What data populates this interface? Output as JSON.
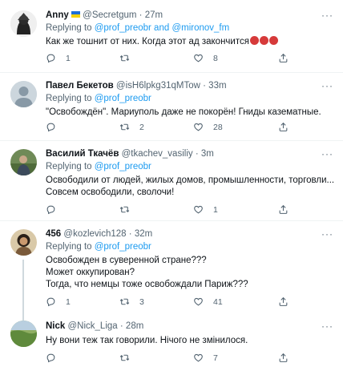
{
  "tweets": [
    {
      "name": "Anny",
      "handle": "@Secretgum",
      "time": "27m",
      "replying_prefix": "Replying to ",
      "replying_to": "@prof_preobr and @mironov_fm",
      "lines": [
        "Как же тошнит от них. Когда этот ад закончится"
      ],
      "emoji": [
        "angry-face",
        "angry-face",
        "angry-face"
      ],
      "replies": "1",
      "retweets": "",
      "likes": "8"
    },
    {
      "name": "Павел Бекетов",
      "handle": "@isH6lpkg31qMTow",
      "time": "33m",
      "replying_prefix": "Replying to ",
      "replying_to": "@prof_preobr",
      "lines": [
        "\"Освобождён\". Мариуполь даже не покорён! Гниды казематные."
      ],
      "replies": "",
      "retweets": "2",
      "likes": "28"
    },
    {
      "name": "Василий Ткачёв",
      "handle": "@tkachev_vasiliy",
      "time": "3m",
      "replying_prefix": "Replying to ",
      "replying_to": "@prof_preobr",
      "lines": [
        "Освободили от людей, жилых домов, промышленности, торговли...",
        "Совсем освободили, сволочи!"
      ],
      "replies": "",
      "retweets": "",
      "likes": "1"
    },
    {
      "name": "456",
      "handle": "@kozlevich128",
      "time": "32m",
      "replying_prefix": "Replying to ",
      "replying_to": "@prof_preobr",
      "lines": [
        "Освобожден в суверенной стране???",
        "Может оккупирован?",
        "Тогда, что немцы тоже освобождали Париж???"
      ],
      "replies": "1",
      "retweets": "3",
      "likes": "41"
    },
    {
      "name": "Nick",
      "handle": "@Nick_Liga",
      "time": "28m",
      "lines": [
        "Ну вони теж так говорили. Нічого не змінилося."
      ],
      "replies": "",
      "retweets": "",
      "likes": "7"
    }
  ],
  "separator": "·",
  "more_glyph": "···",
  "colors": {
    "link": "#1d9bf0",
    "muted": "#536471",
    "divider": "#eff3f4"
  }
}
